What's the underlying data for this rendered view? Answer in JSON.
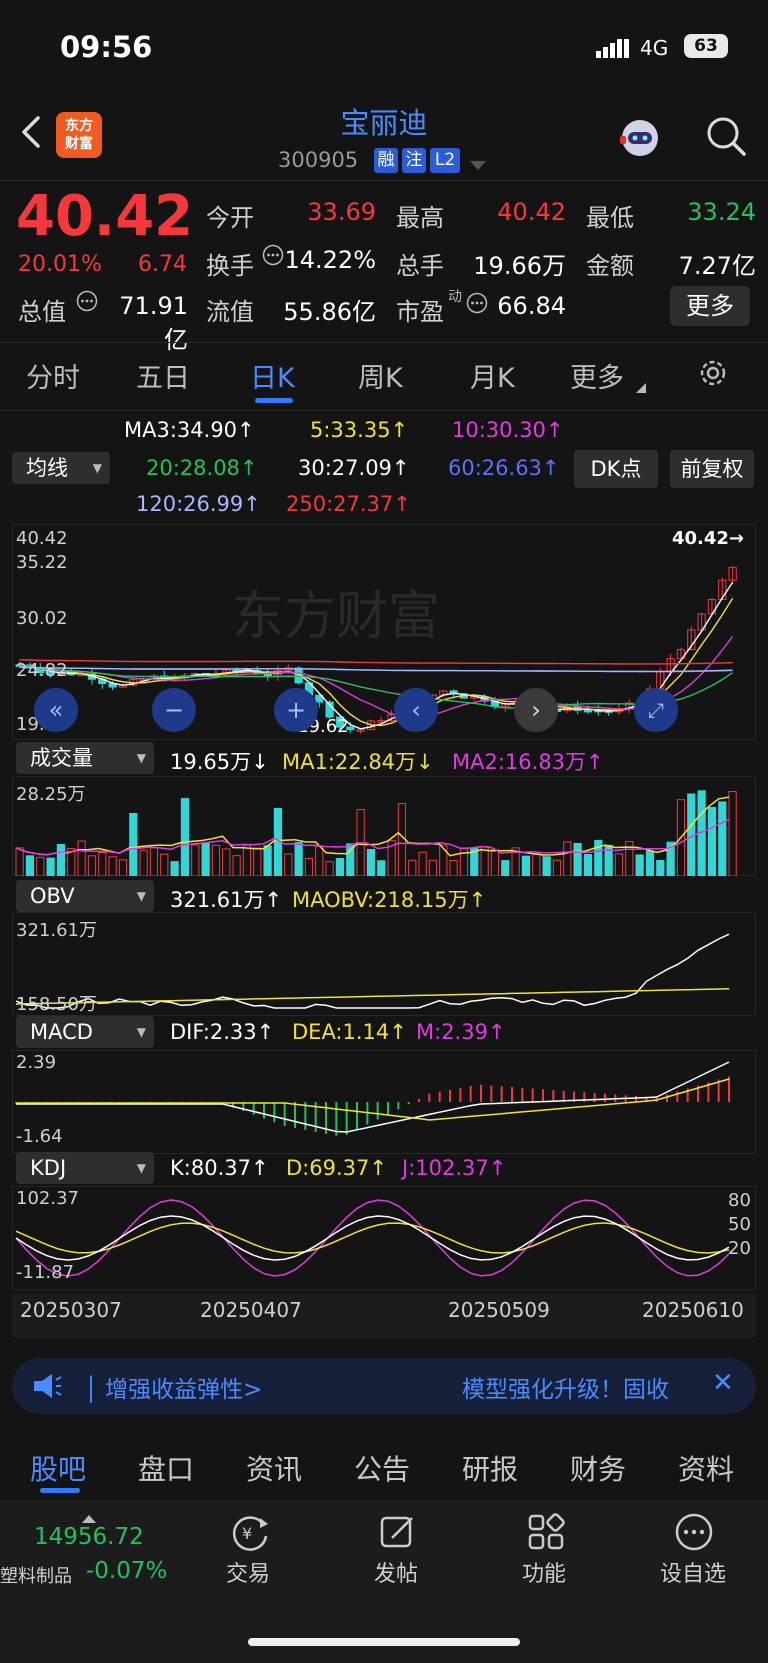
{
  "status": {
    "time": "09:56",
    "network": "4G",
    "battery": "63"
  },
  "header": {
    "stock_name": "宝丽迪",
    "stock_code": "300905",
    "tags": [
      "融",
      "注",
      "L2"
    ],
    "logo_text": [
      "东方",
      "财富"
    ]
  },
  "quote": {
    "price": "40.42",
    "pct": "20.01%",
    "change": "6.74",
    "fields": {
      "open_label": "今开",
      "open": "33.69",
      "high_label": "最高",
      "high": "40.42",
      "low_label": "最低",
      "low": "33.24",
      "turnover_label": "换手",
      "turnover": "14.22%",
      "volume_label": "总手",
      "volume": "19.66万",
      "amount_label": "金额",
      "amount": "7.27亿",
      "total_value_label": "总值",
      "total_value": "71.91亿",
      "float_label": "流值",
      "float_value": "55.86亿",
      "pe_label": "市盈",
      "pe_sup": "动",
      "pe": "66.84"
    },
    "more_button": "更多"
  },
  "period_tabs": [
    "分时",
    "五日",
    "日K",
    "周K",
    "月K",
    "更多"
  ],
  "ma": {
    "dropdown": "均线",
    "ma3": "MA3:34.90↑",
    "ma5": "5:33.35↑",
    "ma10": "10:30.30↑",
    "ma20": "20:28.08↑",
    "ma30": "30:27.09↑",
    "ma60": "60:26.63↑",
    "ma120": "120:26.99↑",
    "ma250": "250:27.37↑",
    "dk_button": "DK点",
    "fq_button": "前复权"
  },
  "kline": {
    "axis": [
      "40.42",
      "35.22",
      "30.02",
      "24.82",
      "19.62"
    ],
    "high_marker": "40.42→",
    "low_marker": "←19.62",
    "watermark": "东方财富"
  },
  "volume": {
    "dropdown": "成交量",
    "value": "19.65万↓",
    "ma1": "MA1:22.84万↓",
    "ma2": "MA2:16.83万↑",
    "axis_top": "28.25万"
  },
  "obv": {
    "dropdown": "OBV",
    "value": "321.61万↑",
    "maobv": "MAOBV:218.15万↑",
    "axis_top": "321.61万",
    "axis_bottom": "158.50万"
  },
  "macd": {
    "dropdown": "MACD",
    "dif": "DIF:2.33↑",
    "dea": "DEA:1.14↑",
    "m": "M:2.39↑",
    "axis_top": "2.39",
    "axis_bottom": "-1.64"
  },
  "kdj": {
    "dropdown": "KDJ",
    "k": "K:80.37↑",
    "d": "D:69.37↑",
    "j": "J:102.37↑",
    "axis_top": "102.37",
    "axis_bottom": "-11.87",
    "right_axis": [
      "80",
      "50",
      "20"
    ]
  },
  "dates": [
    "20250307",
    "20250407",
    "20250509",
    "20250610"
  ],
  "banner": {
    "left": "│ 增强收益弹性>",
    "right": "模型强化升级！固收",
    "close": "✕"
  },
  "bottom_tabs": [
    "股吧",
    "盘口",
    "资讯",
    "公告",
    "研报",
    "财务",
    "资料"
  ],
  "footer": {
    "index_value": "14956.72",
    "index_name": "塑料制品",
    "index_pct": "-0.07%",
    "nav": [
      "交易",
      "发帖",
      "功能",
      "设自选"
    ]
  },
  "colors": {
    "up": "#f5383c",
    "down": "#22c25a",
    "accent": "#4a8cff",
    "bg": "#141414"
  }
}
